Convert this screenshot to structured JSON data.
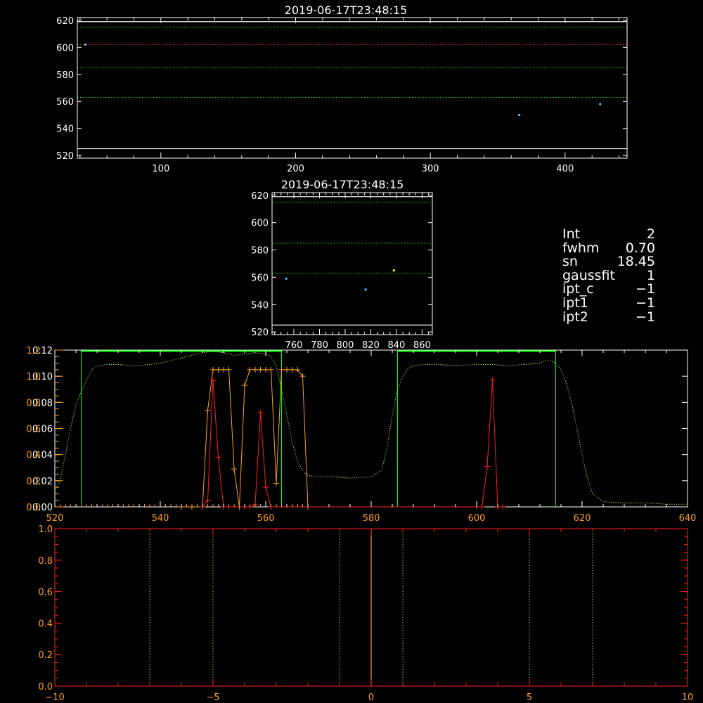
{
  "info": {
    "rows": [
      {
        "key": "Int",
        "value": "2"
      },
      {
        "key": "fwhm",
        "value": "0.70"
      },
      {
        "key": "sn",
        "value": "18.45"
      },
      {
        "key": "gaussfit",
        "value": "1"
      },
      {
        "key": "ipt_c",
        "value": "−1"
      },
      {
        "key": "ipt1",
        "value": "−1"
      },
      {
        "key": "ipt2",
        "value": "−1"
      }
    ]
  },
  "colors": {
    "background": "#000000",
    "axes": "#ffffff",
    "red": "#ff2020",
    "orange": "#ffa020",
    "green": "#00ff00",
    "light_green": "#a0ff60",
    "cyan": "#40c0ff",
    "yellow": "#ffff00"
  },
  "chart_data": [
    {
      "type": "scatter",
      "title": "2019-06-17T23:48:15",
      "xlim": [
        38,
        446
      ],
      "ylim": [
        518,
        622
      ],
      "xticks": [
        100,
        200,
        300,
        400
      ],
      "yticks": [
        520,
        540,
        560,
        580,
        600,
        620
      ],
      "hlines": [
        {
          "y": 619,
          "style": "solid",
          "color": "white"
        },
        {
          "y": 615,
          "style": "dotted",
          "color": "green"
        },
        {
          "y": 602,
          "style": "dotted",
          "color": "red"
        },
        {
          "y": 585,
          "style": "dotted",
          "color": "green"
        },
        {
          "y": 563,
          "style": "dotted",
          "color": "green"
        },
        {
          "y": 525,
          "style": "solid",
          "color": "white"
        }
      ],
      "points": [
        {
          "x": 44,
          "y": 602,
          "color": "cyan"
        },
        {
          "x": 366,
          "y": 550,
          "color": "cyan"
        },
        {
          "x": 426,
          "y": 558,
          "color": "cyan"
        }
      ]
    },
    {
      "type": "scatter",
      "title": "2019-06-17T23:48:15",
      "xlim": [
        743,
        868
      ],
      "ylim": [
        518,
        622
      ],
      "xticks": [
        760,
        780,
        800,
        820,
        840,
        860
      ],
      "yticks": [
        520,
        540,
        560,
        580,
        600,
        620
      ],
      "hlines": [
        {
          "y": 619,
          "style": "solid",
          "color": "white"
        },
        {
          "y": 615,
          "style": "dotted",
          "color": "green"
        },
        {
          "y": 585,
          "style": "dotted",
          "color": "green"
        },
        {
          "y": 563,
          "style": "dotted",
          "color": "green"
        },
        {
          "y": 525,
          "style": "solid",
          "color": "white"
        }
      ],
      "points": [
        {
          "x": 754,
          "y": 559,
          "color": "cyan"
        },
        {
          "x": 816,
          "y": 551,
          "color": "cyan"
        },
        {
          "x": 838,
          "y": 565,
          "color": "yellow"
        }
      ]
    },
    {
      "type": "line",
      "xlim": [
        520,
        640
      ],
      "xticks": [
        520,
        540,
        560,
        580,
        600,
        620,
        640
      ],
      "y_left_white": {
        "ylim": [
          0,
          0.12
        ],
        "ticks": [
          "0.00",
          "0.02",
          "0.04",
          "0.06",
          "0.08",
          "0.10",
          "0.12"
        ]
      },
      "y_left_orange": {
        "ylim": [
          0,
          1.2
        ],
        "ticks": [
          "0.0",
          "0.2",
          "0.4",
          "0.6",
          "0.8",
          "1.0",
          "1.2"
        ]
      },
      "filter_boxes": [
        {
          "x0": 525,
          "x1": 563,
          "top": 1.2,
          "color": "green"
        },
        {
          "x0": 585,
          "x1": 615,
          "top": 1.2,
          "color": "green"
        }
      ],
      "series": [
        {
          "color": "light_green",
          "style": "dotted",
          "x": [
            520,
            521,
            522,
            523,
            524,
            525,
            526,
            527,
            528,
            530,
            532,
            535,
            538,
            540,
            543,
            546,
            548,
            550,
            552,
            554,
            556,
            558,
            560,
            561,
            562,
            563,
            564,
            565,
            566,
            567,
            568,
            570,
            573,
            576,
            580,
            582,
            583,
            584,
            585,
            586,
            587,
            588,
            590,
            593,
            596,
            600,
            603,
            606,
            609,
            612,
            613,
            614,
            615,
            616,
            617,
            618,
            619,
            620,
            621,
            622,
            624,
            628,
            632,
            636,
            640
          ],
          "y": [
            0.012,
            0.02,
            0.04,
            0.06,
            0.078,
            0.088,
            0.097,
            0.105,
            0.108,
            0.109,
            0.109,
            0.108,
            0.109,
            0.11,
            0.113,
            0.116,
            0.118,
            0.119,
            0.118,
            0.116,
            0.117,
            0.118,
            0.117,
            0.115,
            0.108,
            0.09,
            0.07,
            0.05,
            0.035,
            0.028,
            0.024,
            0.023,
            0.023,
            0.022,
            0.023,
            0.028,
            0.045,
            0.07,
            0.09,
            0.1,
            0.106,
            0.108,
            0.109,
            0.109,
            0.108,
            0.109,
            0.109,
            0.108,
            0.109,
            0.11,
            0.112,
            0.112,
            0.11,
            0.105,
            0.095,
            0.08,
            0.06,
            0.04,
            0.022,
            0.01,
            0.004,
            0.003,
            0.003,
            0.002,
            0.002
          ]
        },
        {
          "color": "orange",
          "style": "solid-plus",
          "x": [
            544,
            546,
            548,
            549,
            550,
            551,
            552,
            553,
            554,
            555,
            556,
            557,
            558,
            559,
            560,
            561,
            562,
            563,
            564,
            565,
            566,
            567,
            568
          ],
          "y": [
            0,
            0,
            0,
            0.74,
            1.05,
            1.05,
            1.05,
            1.05,
            0.29,
            0,
            0.93,
            1.05,
            1.05,
            1.05,
            1.05,
            1.05,
            0.18,
            1.05,
            1.05,
            1.05,
            1.05,
            1.0,
            0
          ]
        },
        {
          "color": "red",
          "style": "solid-plus",
          "x": [
            548,
            549,
            550,
            551,
            552,
            553,
            556,
            557,
            558,
            559,
            560,
            561,
            600,
            601,
            602,
            603,
            604,
            605
          ],
          "y": [
            0,
            0.05,
            0.965,
            0.38,
            0,
            0,
            0,
            0,
            0.02,
            0.72,
            0.15,
            0,
            0,
            0,
            0.31,
            0.97,
            0,
            0
          ]
        }
      ]
    },
    {
      "type": "line",
      "xlim": [
        -10,
        10
      ],
      "ylim": [
        0,
        1
      ],
      "xticks": [
        "−10",
        "−5",
        "0",
        "5",
        "10"
      ],
      "yticks": [
        "0.0",
        "0.2",
        "0.4",
        "0.6",
        "0.8",
        "1.0"
      ],
      "vlines_dotted": [
        -7,
        -5,
        -1,
        1,
        5,
        7
      ],
      "vline_solid": 0
    }
  ]
}
